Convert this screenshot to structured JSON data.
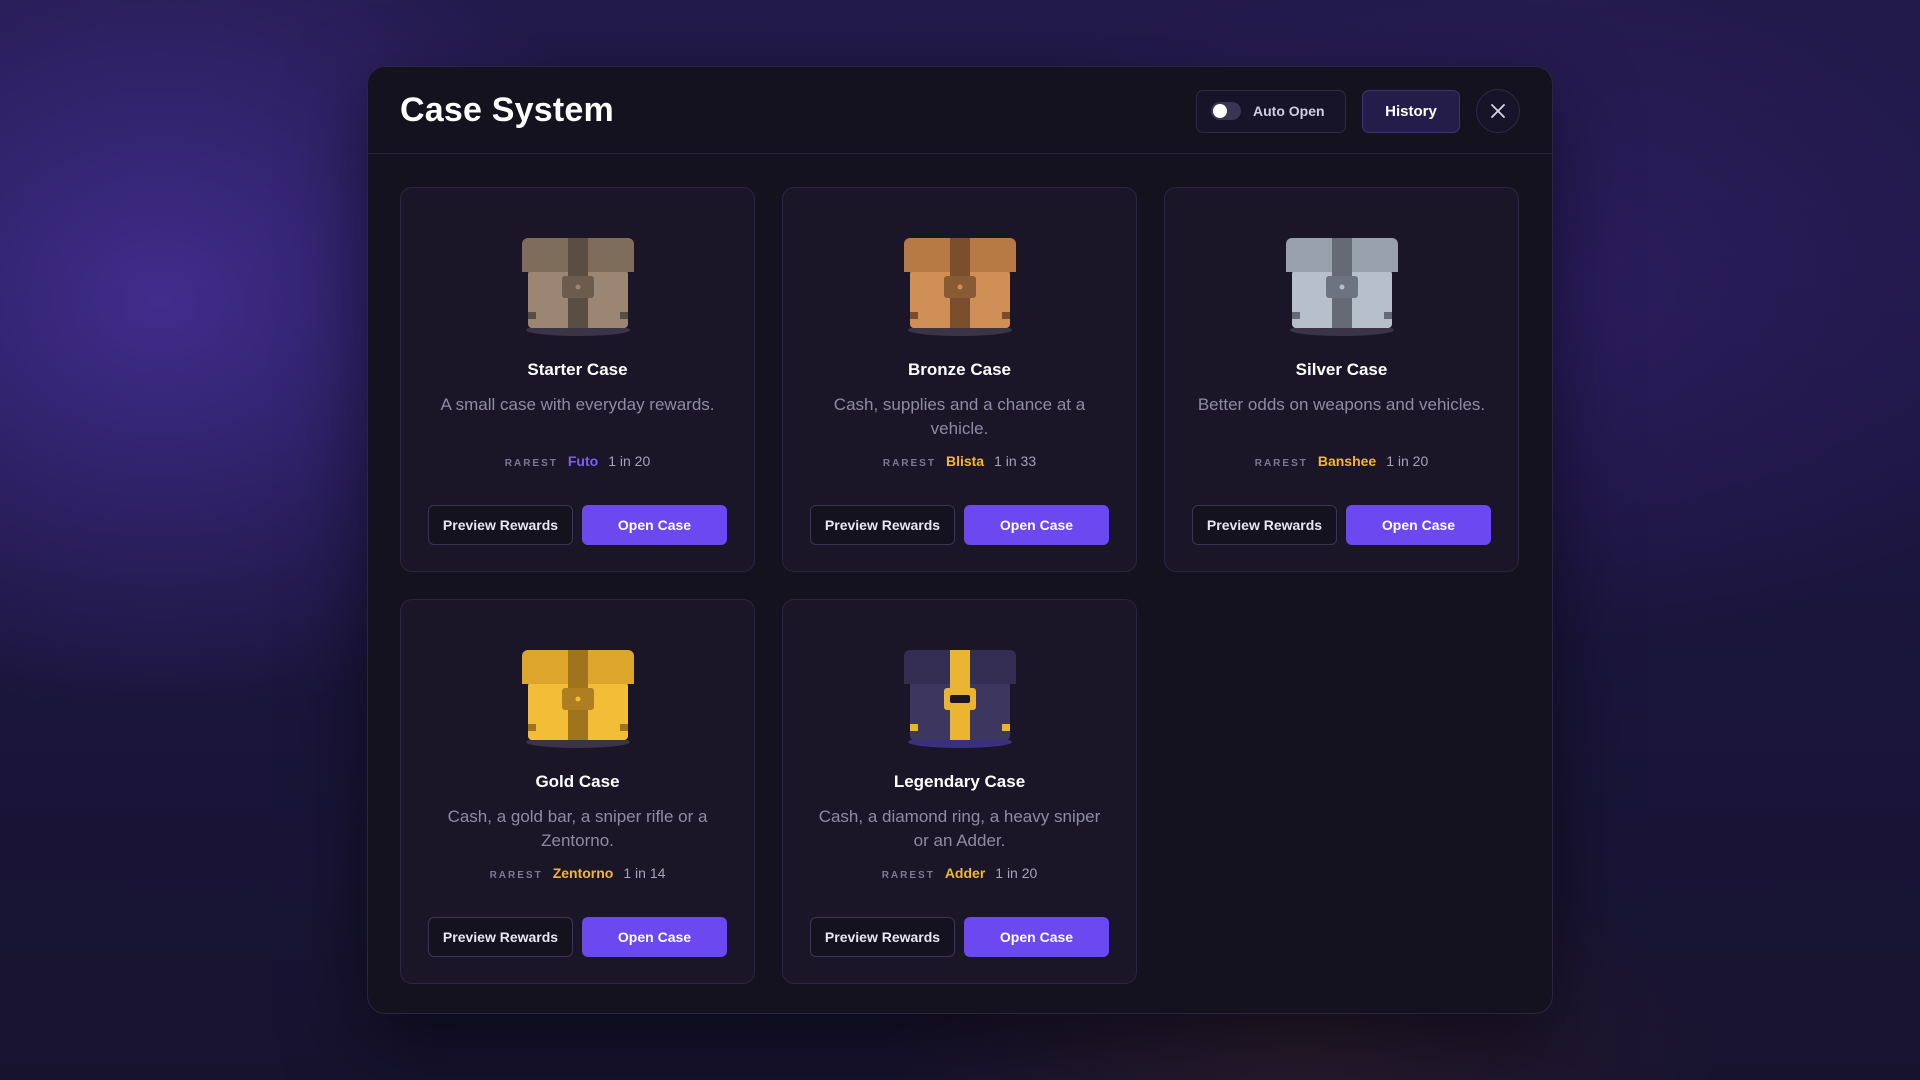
{
  "modal": {
    "title": "Case System",
    "auto_open_label": "Auto Open",
    "auto_open_enabled": false,
    "history_label": "History",
    "close_icon": "close-icon"
  },
  "colors": {
    "accent": "#6b48f0",
    "rarity_purple": "#7c5cff",
    "rarity_gold": "#f2b632"
  },
  "cases": [
    {
      "title": "Starter Case",
      "description": "A small case with everyday rewards.",
      "rarest_label": "RAREST",
      "rarest_item": "Futo",
      "rarest_color": "#7c5cff",
      "odds": "1 in 20",
      "preview_label": "Preview Rewards",
      "open_label": "Open Case",
      "icon": "starter-chest-icon",
      "chest": {
        "body": "#9a8672",
        "lid": "#7f6d5c",
        "strap": "#5a4d42",
        "lock": "#6b5c4e",
        "base": "#3b3446"
      }
    },
    {
      "title": "Bronze Case",
      "description": "Cash, supplies and a chance at a vehicle.",
      "rarest_label": "RAREST",
      "rarest_item": "Blista",
      "rarest_color": "#f2b632",
      "odds": "1 in 33",
      "preview_label": "Preview Rewards",
      "open_label": "Open Case",
      "icon": "bronze-chest-icon",
      "chest": {
        "body": "#cf8f57",
        "lid": "#b87a44",
        "strap": "#7a4d2c",
        "lock": "#8a5a34",
        "base": "#3b3446"
      }
    },
    {
      "title": "Silver Case",
      "description": "Better odds on weapons and vehicles.",
      "rarest_label": "RAREST",
      "rarest_item": "Banshee",
      "rarest_color": "#f2b632",
      "odds": "1 in 20",
      "preview_label": "Preview Rewards",
      "open_label": "Open Case",
      "icon": "silver-chest-icon",
      "chest": {
        "body": "#b7c0ca",
        "lid": "#98a1ab",
        "strap": "#666a75",
        "lock": "#6e7380",
        "base": "#3b3446"
      }
    },
    {
      "title": "Gold Case",
      "description": "Cash, a gold bar, a sniper rifle or a Zentorno.",
      "rarest_label": "RAREST",
      "rarest_item": "Zentorno",
      "rarest_color": "#f2b632",
      "odds": "1 in 14",
      "preview_label": "Preview Rewards",
      "open_label": "Open Case",
      "icon": "gold-chest-icon",
      "chest": {
        "body": "#f2be38",
        "lid": "#dca62c",
        "strap": "#a0731d",
        "lock": "#b07d22",
        "base": "#3b3446"
      }
    },
    {
      "title": "Legendary Case",
      "description": "Cash, a diamond ring, a heavy sniper or an Adder.",
      "rarest_label": "RAREST",
      "rarest_item": "Adder",
      "rarest_color": "#f2b632",
      "odds": "1 in 20",
      "preview_label": "Preview Rewards",
      "open_label": "Open Case",
      "icon": "legendary-chest-icon",
      "chest": {
        "body": "#3d3760",
        "lid": "#332d52",
        "strap": "#e9b533",
        "lock": "#e9b533",
        "base": "#3a2f80"
      }
    }
  ]
}
